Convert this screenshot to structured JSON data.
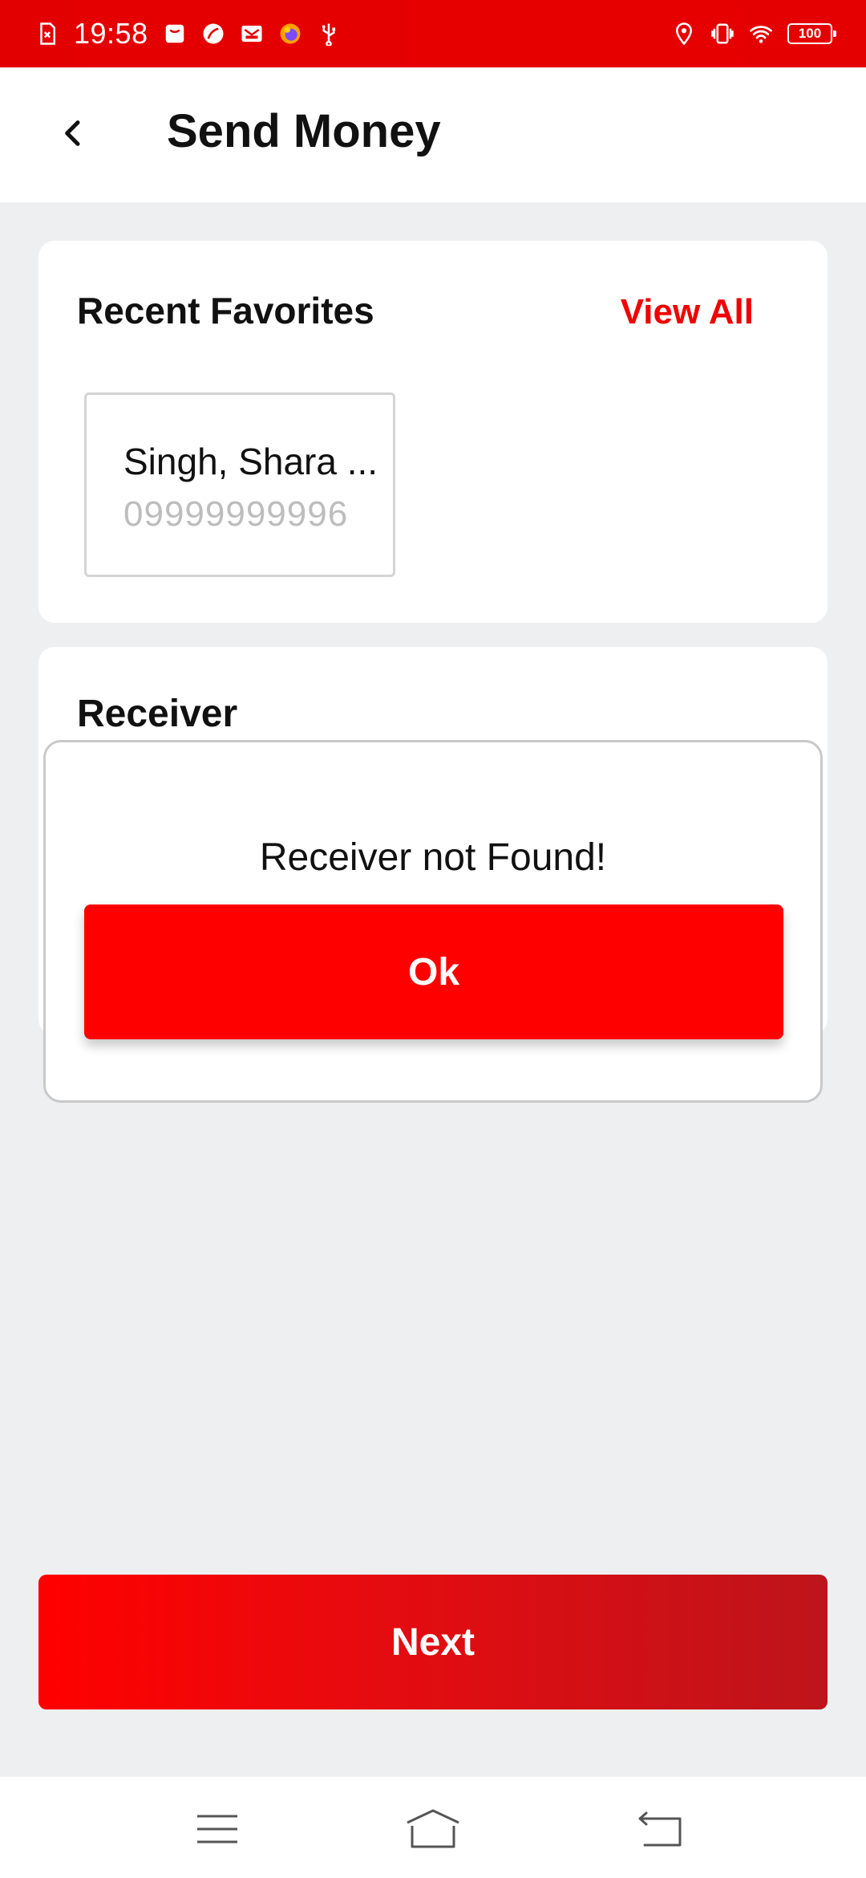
{
  "status_bar": {
    "time": "19:58",
    "battery": "100",
    "left_icons": [
      "sim-alert-icon",
      "shopping-bag-icon",
      "leaf-app-icon",
      "mail-icon",
      "browser-icon",
      "usb-icon"
    ],
    "right_icons": [
      "location-icon",
      "vibrate-icon",
      "wifi-icon",
      "battery-icon"
    ]
  },
  "header": {
    "back_icon": "chevron-left-icon",
    "title": "Send Money"
  },
  "favorites": {
    "heading": "Recent Favorites",
    "view_all": "View All",
    "items": [
      {
        "name": "Singh, Shara ...",
        "number": "09999999996"
      }
    ]
  },
  "receiver": {
    "heading": "Receiver"
  },
  "dialog": {
    "message": "Receiver not Found!",
    "ok_label": "Ok"
  },
  "footer": {
    "next_label": "Next"
  },
  "nav_bar": {
    "icons": [
      "menu-icon",
      "home-icon",
      "back-nav-icon"
    ]
  },
  "colors": {
    "brand_red": "#ff0000",
    "status_bar_red": "#e30000",
    "background": "#eeeff1",
    "muted_text": "#bdbdbd"
  }
}
